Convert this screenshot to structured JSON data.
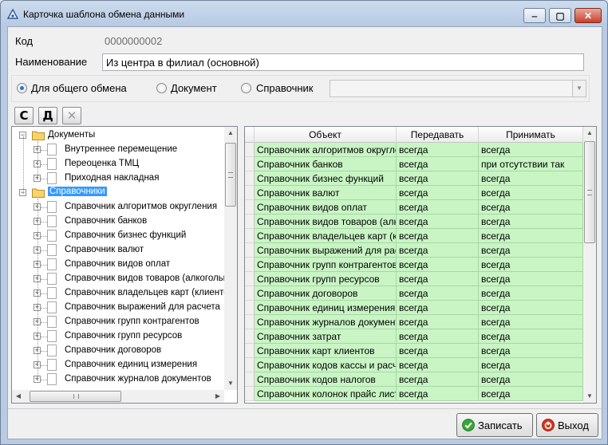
{
  "window": {
    "title": "Карточка шаблона обмена данными",
    "controls": {
      "minimize": "‒",
      "maximize": "▢",
      "close": "✕"
    }
  },
  "form": {
    "code_label": "Код",
    "code_value": "0000000002",
    "name_label": "Наименование",
    "name_value": "Из центра в филиал (основной)"
  },
  "exchange_type": {
    "options": [
      {
        "label": "Для общего обмена",
        "checked": true
      },
      {
        "label": "Документ",
        "checked": false
      },
      {
        "label": "Справочник",
        "checked": false
      }
    ],
    "combo_value": ""
  },
  "toolbar": {
    "create_label": "С",
    "delete_label": "Д",
    "clear_label": "✕"
  },
  "tree": {
    "groups": [
      {
        "label": "Документы",
        "items": [
          "Внутреннее перемещение",
          "Переоценка ТМЦ",
          "Приходная накладная"
        ]
      },
      {
        "label": "Справочники",
        "selected": true,
        "items": [
          "Справочник алгоритмов округления",
          "Справочник банков",
          "Справочник бизнес функций",
          "Справочник валют",
          "Справочник видов оплат",
          "Справочник видов товаров (алкогольная продукция)",
          "Справочник владельцев карт (клиентов)",
          "Справочник выражений для расчета",
          "Справочник групп контрагентов",
          "Справочник групп ресурсов",
          "Справочник договоров",
          "Справочник единиц измерения",
          "Справочник журналов документов"
        ]
      }
    ]
  },
  "grid": {
    "columns": [
      "Объект",
      "Передавать",
      "Принимать"
    ],
    "rows": [
      [
        "Справочник алгоритмов округления",
        "всегда",
        "всегда"
      ],
      [
        "Справочник банков",
        "всегда",
        "при отсутствии так"
      ],
      [
        "Справочник бизнес функций",
        "всегда",
        "всегда"
      ],
      [
        "Справочник валют",
        "всегда",
        "всегда"
      ],
      [
        "Справочник видов оплат",
        "всегда",
        "всегда"
      ],
      [
        "Справочник видов товаров (алкогольная продукция)",
        "всегда",
        "всегда"
      ],
      [
        "Справочник владельцев карт (клиентов)",
        "всегда",
        "всегда"
      ],
      [
        "Справочник выражений для расчета",
        "всегда",
        "всегда"
      ],
      [
        "Справочник групп контрагентов",
        "всегда",
        "всегда"
      ],
      [
        "Справочник групп ресурсов",
        "всегда",
        "всегда"
      ],
      [
        "Справочник договоров",
        "всегда",
        "всегда"
      ],
      [
        "Справочник единиц измерения",
        "всегда",
        "всегда"
      ],
      [
        "Справочник журналов документов",
        "всегда",
        "всегда"
      ],
      [
        "Справочник затрат",
        "всегда",
        "всегда"
      ],
      [
        "Справочник карт клиентов",
        "всегда",
        "всегда"
      ],
      [
        "Справочник кодов кассы и расчета",
        "всегда",
        "всегда"
      ],
      [
        "Справочник кодов налогов",
        "всегда",
        "всегда"
      ],
      [
        "Справочник колонок прайс листа",
        "всегда",
        "всегда"
      ]
    ]
  },
  "buttons": {
    "save_label": "Записать",
    "exit_label": "Выход"
  },
  "colors": {
    "row_background": "#c9f5c5",
    "selection": "#3399ff",
    "save_icon": "#3aa53a",
    "exit_icon": "#d9331a"
  }
}
